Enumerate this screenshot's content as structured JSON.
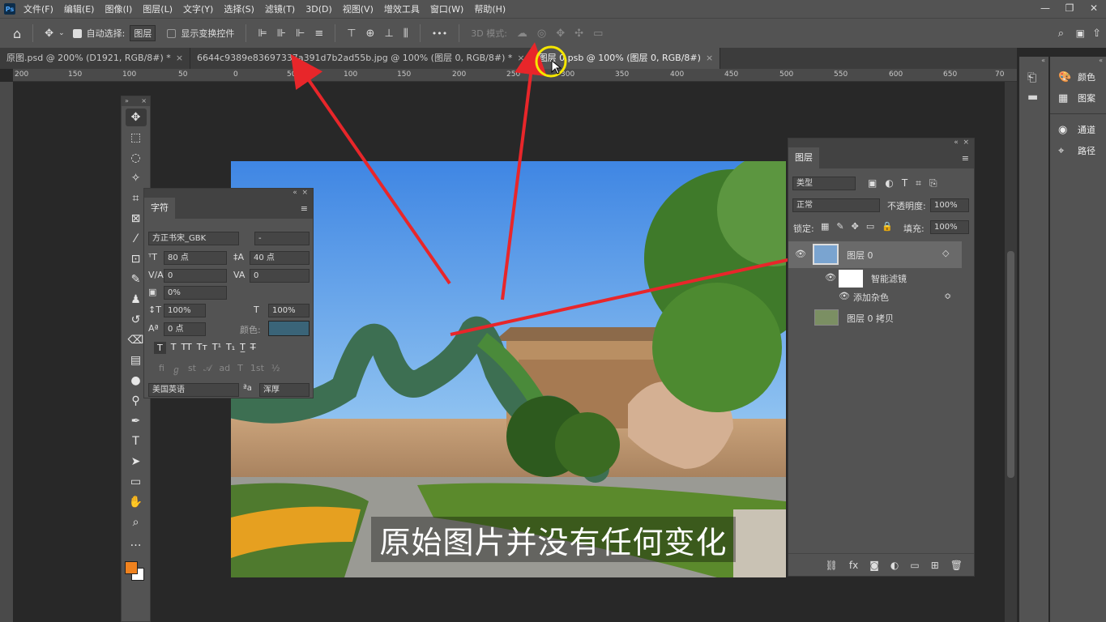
{
  "menubar": {
    "logo": "Ps",
    "items": [
      "文件(F)",
      "编辑(E)",
      "图像(I)",
      "图层(L)",
      "文字(Y)",
      "选择(S)",
      "滤镜(T)",
      "3D(D)",
      "视图(V)",
      "增效工具",
      "窗口(W)",
      "帮助(H)"
    ]
  },
  "options": {
    "auto_select_label": "自动选择:",
    "auto_select_value": "图层",
    "show_transform_label": "显示变换控件",
    "more": "•••",
    "mode_3d": "3D 模式:"
  },
  "tabs": [
    {
      "label": "原图.psd @ 200% (D1921, RGB/8#) *",
      "close": "×"
    },
    {
      "label": "6644c9389e83697337a391d7b2ad55b.jpg @ 100% (图层 0, RGB/8#) *",
      "close": "×"
    },
    {
      "label": "图层 0.psb @ 100% (图层 0, RGB/8#)",
      "close": "×"
    }
  ],
  "ruler_h": [
    "200",
    "150",
    "100",
    "50",
    "0",
    "50",
    "100",
    "150",
    "200",
    "250",
    "300",
    "350",
    "400",
    "450",
    "500",
    "550",
    "600",
    "650",
    "70"
  ],
  "character_panel": {
    "title": "字符",
    "font_family": "方正书宋_GBK",
    "font_style": "-",
    "font_size": "80 点",
    "leading": "40 点",
    "kerning": "0",
    "tracking": "0",
    "scale_pct": "0%",
    "vertical_scale": "100%",
    "horizontal_scale": "100%",
    "baseline_shift": "0 点",
    "color_label": "颜色:",
    "color": "#3a6478",
    "language": "美国英语",
    "aa_label": "ªa",
    "anti_alias": "浑厚"
  },
  "layers_panel": {
    "title": "图层",
    "filter_kind": "类型",
    "blend_mode": "正常",
    "opacity_label": "不透明度:",
    "opacity": "100%",
    "lock_label": "锁定:",
    "fill_label": "填充:",
    "fill": "100%",
    "layers": [
      {
        "name": "图层 0"
      },
      {
        "name": "智能滤镜"
      },
      {
        "name": "添加杂色"
      },
      {
        "name": "图层 0 拷贝"
      }
    ],
    "footer_fx": "fx"
  },
  "right_panels": [
    {
      "label": "颜色"
    },
    {
      "label": "图案"
    },
    {
      "label": "通道"
    },
    {
      "label": "路径"
    }
  ],
  "subtitle": "原始图片并没有任何变化",
  "colors": {
    "foreground": "#f0821e",
    "background": "#ffffff",
    "annotation": "#e8262a",
    "cursor_highlight": "#f5e600"
  }
}
